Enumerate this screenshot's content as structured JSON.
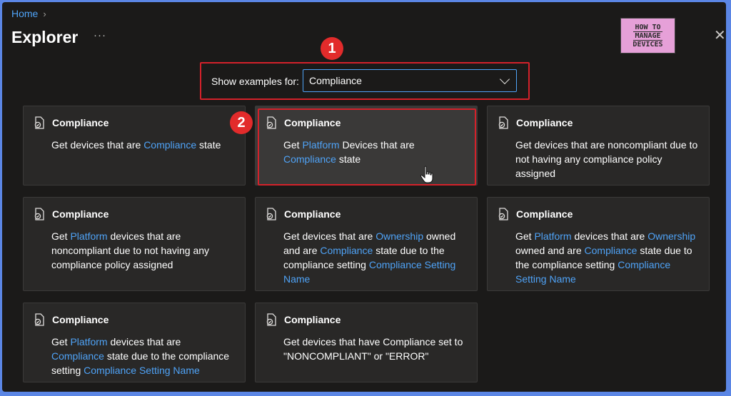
{
  "breadcrumb": {
    "home": "Home"
  },
  "page": {
    "title": "Explorer",
    "more": "···",
    "close": "✕"
  },
  "logo": {
    "line1": "HOW TO",
    "line2": "MANAGE",
    "line3": "DEVICES"
  },
  "annotations": {
    "one": "1",
    "two": "2"
  },
  "filter": {
    "label": "Show examples for:",
    "value": "Compliance"
  },
  "cards": [
    {
      "title": "Compliance",
      "desc": [
        {
          "t": "Get devices that are "
        },
        {
          "t": "Compliance",
          "v": true
        },
        {
          "t": " state"
        }
      ]
    },
    {
      "title": "Compliance",
      "desc": [
        {
          "t": "Get "
        },
        {
          "t": "Platform",
          "v": true
        },
        {
          "t": " Devices that are "
        },
        {
          "t": "Compliance",
          "v": true
        },
        {
          "t": " state"
        }
      ]
    },
    {
      "title": "Compliance",
      "desc": [
        {
          "t": "Get devices that are noncompliant due to not having any compliance policy assigned"
        }
      ]
    },
    {
      "title": "Compliance",
      "desc": [
        {
          "t": "Get "
        },
        {
          "t": "Platform",
          "v": true
        },
        {
          "t": " devices that are noncompliant due to not having any compliance policy assigned"
        }
      ]
    },
    {
      "title": "Compliance",
      "desc": [
        {
          "t": "Get devices that are "
        },
        {
          "t": "Ownership",
          "v": true
        },
        {
          "t": " owned and are "
        },
        {
          "t": "Compliance",
          "v": true
        },
        {
          "t": " state due to the compliance setting "
        },
        {
          "t": "Compliance Setting Name",
          "v": true
        }
      ]
    },
    {
      "title": "Compliance",
      "desc": [
        {
          "t": "Get "
        },
        {
          "t": "Platform",
          "v": true
        },
        {
          "t": " devices that are "
        },
        {
          "t": "Ownership",
          "v": true
        },
        {
          "t": " owned and are "
        },
        {
          "t": "Compliance",
          "v": true
        },
        {
          "t": " state due to the compliance setting "
        },
        {
          "t": "Compliance Setting Name",
          "v": true
        }
      ]
    },
    {
      "title": "Compliance",
      "desc": [
        {
          "t": "Get "
        },
        {
          "t": "Platform",
          "v": true
        },
        {
          "t": " devices that are "
        },
        {
          "t": "Compliance",
          "v": true
        },
        {
          "t": " state due to the compliance setting "
        },
        {
          "t": "Compliance Setting Name",
          "v": true
        }
      ]
    },
    {
      "title": "Compliance",
      "desc": [
        {
          "t": "Get devices that have Compliance set to \"NONCOMPLIANT\" or \"ERROR\""
        }
      ]
    }
  ],
  "colors": {
    "accent": "#4fa3f7",
    "highlight": "#d4212a",
    "background": "#1b1a19",
    "card": "#292827"
  }
}
